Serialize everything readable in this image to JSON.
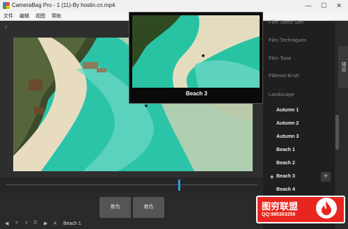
{
  "window": {
    "title": "CameraBag Pro - 1 (11)-By hoslin.cn.mp4",
    "minimize": "—",
    "maximize": "☐",
    "close": "✕"
  },
  "menu": [
    "文件",
    "编辑",
    "视图",
    "帮助"
  ],
  "preview": {
    "label": "Beach 3"
  },
  "panel": {
    "categories": [
      "Film Stock Sim",
      "Film Techniques",
      "Film Tone",
      "Filtered B+W",
      "Landscape"
    ],
    "items": [
      "Autumn 1",
      "Autumn 2",
      "Autumn 3",
      "Beach 1",
      "Beach 2",
      "Beach 3",
      "Beach 4"
    ],
    "selected": "Beach 3",
    "side_tab": "预设",
    "add": "+"
  },
  "bottom": {
    "tiles": [
      "着色",
      "着色"
    ],
    "controls": [
      "◀",
      "<",
      ">",
      "⏱",
      "▶",
      "✕"
    ],
    "status": "Beach 1"
  },
  "watermark": {
    "title": "图穷联盟",
    "qq": "QQ:985303259"
  },
  "colors": {
    "accent": "#2f9fe0",
    "water": "#2bc4a8",
    "sand": "#e8dcc0",
    "watermark": "#e8261f"
  }
}
